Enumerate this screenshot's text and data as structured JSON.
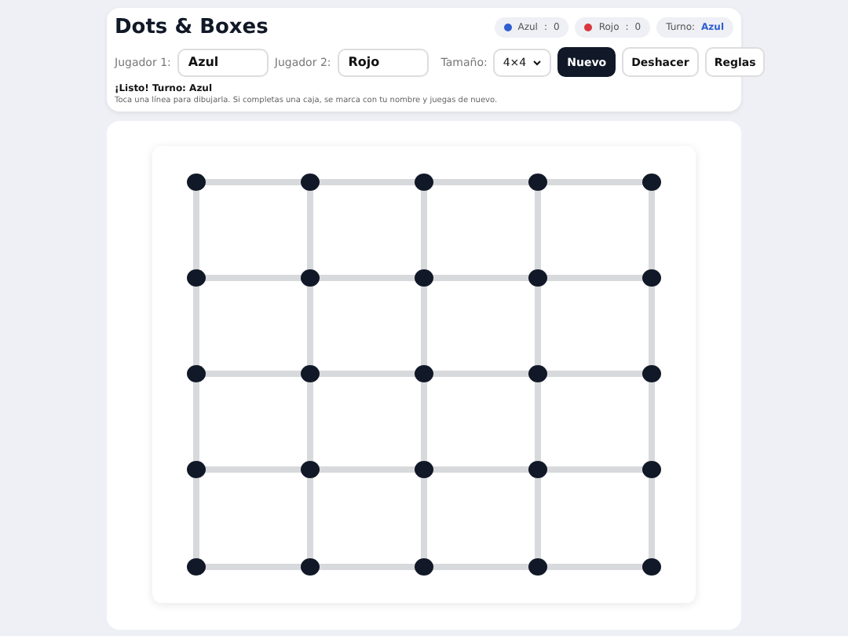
{
  "title": "Dots & Boxes",
  "scores": [
    {
      "name": "Azul",
      "separator": ":",
      "score": "0",
      "color": "#2f5fd0"
    },
    {
      "name": "Rojo",
      "separator": ":",
      "score": "0",
      "color": "#d8383f"
    }
  ],
  "turn": {
    "label": "Turno:",
    "value": "Azul"
  },
  "players": [
    {
      "label": "Jugador 1:",
      "value": "Azul"
    },
    {
      "label": "Jugador 2:",
      "value": "Rojo"
    }
  ],
  "size": {
    "label": "Tamaño:",
    "value": "4×4"
  },
  "buttons": [
    {
      "label": "Nuevo",
      "primary": true
    },
    {
      "label": "Deshacer",
      "primary": false
    },
    {
      "label": "Reglas",
      "primary": false
    }
  ],
  "status": "¡Listo! Turno: Azul",
  "hint": "Toca una línea para dibujarla. Si completas una caja, se marca con tu nombre y juegas de nuevo."
}
